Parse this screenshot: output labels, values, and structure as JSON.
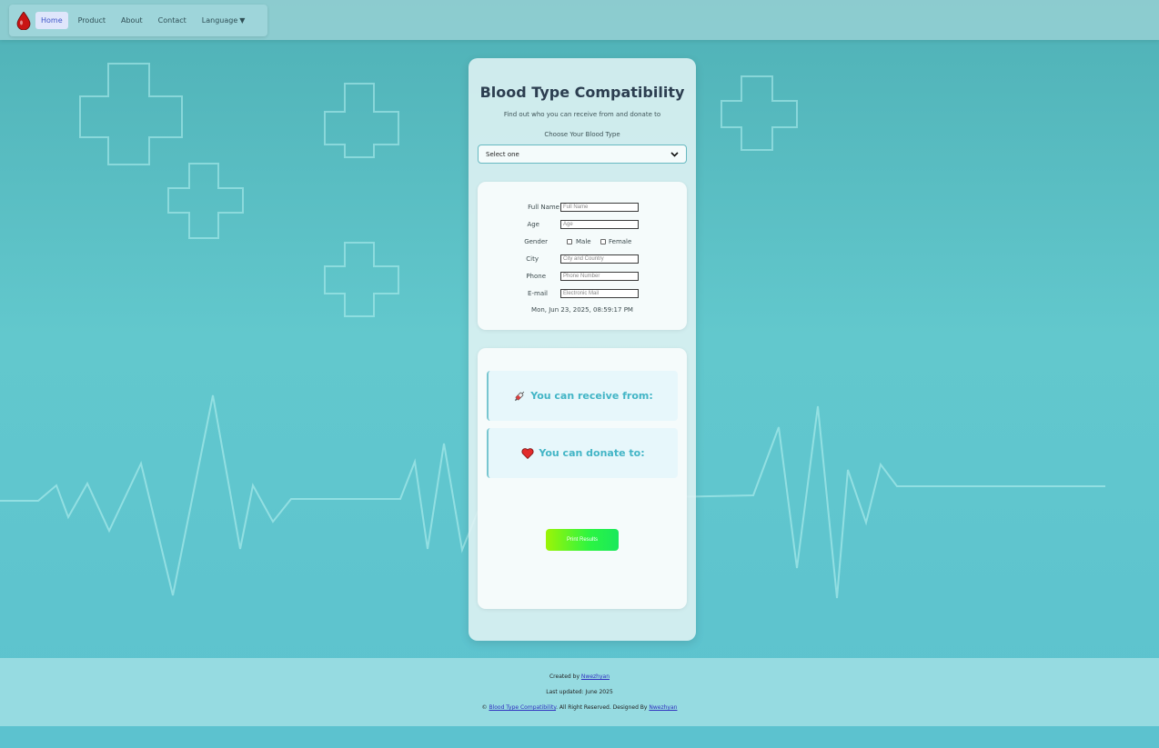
{
  "nav": {
    "items": [
      {
        "label": "Home",
        "active": true
      },
      {
        "label": "Product",
        "active": false
      },
      {
        "label": "About",
        "active": false
      },
      {
        "label": "Contact",
        "active": false
      },
      {
        "label": "Language",
        "active": false
      }
    ],
    "language_caret": "▼",
    "logo_icon": "blood-drop-logo",
    "active_bg": "#dfe6fb",
    "active_color": "#3d55c8"
  },
  "card": {
    "title": "Blood Type Compatibility",
    "subtitle": "Find out who you can receive from and donate to",
    "choose_label": "Choose Your Blood Type",
    "select_value": "Select one"
  },
  "form": {
    "full_name": {
      "label": "Full Name",
      "placeholder": "Full Name"
    },
    "age": {
      "label": "Age",
      "placeholder": "Age"
    },
    "gender": {
      "label": "Gender",
      "options": [
        "Male",
        "Female"
      ]
    },
    "city": {
      "label": "City",
      "placeholder": "City and Country"
    },
    "phone": {
      "label": "Phone",
      "placeholder": "Phone Number"
    },
    "email": {
      "label": "E-mail",
      "placeholder": "Electronic Mail"
    },
    "datetime": "Mon, Jun 23, 2025, 08:59:17 PM"
  },
  "results": {
    "receive_label": "You can receive from:",
    "receive_icon": "syringe-icon",
    "donate_label": "You can donate to:",
    "donate_icon": "heart-icon",
    "print_label": "Print Results",
    "accent_color": "#43b5c6"
  },
  "footer": {
    "created_by_prefix": "Created by",
    "created_by_link": "Nwezhyan",
    "last_updated": "Last updated: June 2025",
    "copyright_prefix": "©",
    "copyright_link": "Blood Type Compatibility",
    "copyright_mid": ". All Right Reserved. Designed By",
    "designer_link": "Nwezhyan"
  }
}
